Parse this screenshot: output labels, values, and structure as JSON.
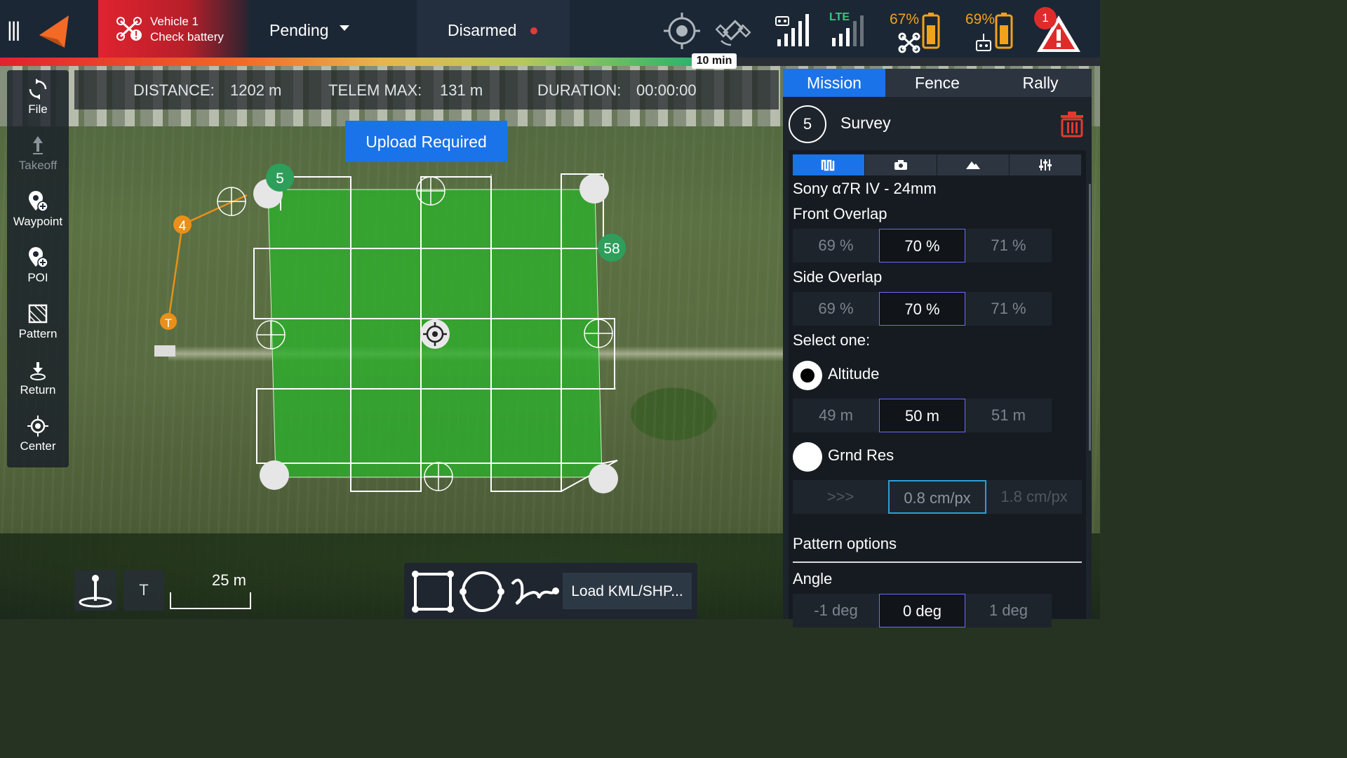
{
  "topbar": {
    "vehicle_name": "Vehicle 1",
    "vehicle_status": "Check battery",
    "flight_mode": "Pending",
    "arm_state": "Disarmed",
    "lte_label": "LTE",
    "drone_battery": "67%",
    "controller_battery": "69%",
    "alert_count": "1",
    "flight_time": "10 min",
    "progress_fraction": 0.63
  },
  "stats": {
    "distance_label": "DISTANCE:",
    "distance_value": "1202 m",
    "telem_label": "TELEM MAX:",
    "telem_value": "131 m",
    "duration_label": "DURATION:",
    "duration_value": "00:00:00"
  },
  "left_toolbar": {
    "items": [
      {
        "label": "File",
        "icon": "file-sync-icon",
        "enabled": true
      },
      {
        "label": "Takeoff",
        "icon": "takeoff-icon",
        "enabled": false
      },
      {
        "label": "Waypoint",
        "icon": "waypoint-icon",
        "enabled": true
      },
      {
        "label": "POI",
        "icon": "poi-icon",
        "enabled": true
      },
      {
        "label": "Pattern",
        "icon": "pattern-icon",
        "enabled": true
      },
      {
        "label": "Return",
        "icon": "return-icon",
        "enabled": true
      },
      {
        "label": "Center",
        "icon": "center-icon",
        "enabled": true
      }
    ]
  },
  "map": {
    "upload_button": "Upload Required",
    "markers": {
      "takeoff": "T",
      "wp4": "4",
      "survey_start": "5",
      "survey_end": "58"
    },
    "scale_label": "25 m",
    "takeoff_toggle": "T",
    "load_kml": "Load KML/SHP..."
  },
  "right_panel": {
    "tabs": [
      "Mission",
      "Fence",
      "Rally"
    ],
    "active_tab": "Mission",
    "seq": "5",
    "item_title": "Survey",
    "camera": "Sony α7R IV - 24mm",
    "front_overlap_label": "Front Overlap",
    "front_overlap": [
      "69 %",
      "70 %",
      "71 %"
    ],
    "side_overlap_label": "Side Overlap",
    "side_overlap": [
      "69 %",
      "70 %",
      "71 %"
    ],
    "select_one": "Select one:",
    "altitude_label": "Altitude",
    "altitude": [
      "49 m",
      "50 m",
      "51 m"
    ],
    "grnd_res_label": "Grnd Res",
    "grnd_res": [
      ">>>",
      "0.8 cm/px",
      "1.8 cm/px"
    ],
    "pattern_options": "Pattern options",
    "angle_label": "Angle",
    "angle": [
      "-1 deg",
      "0 deg",
      "1 deg"
    ]
  },
  "colors": {
    "accent": "#1a73e8",
    "alert": "#e0232f",
    "battery": "#f2a21a",
    "survey_fill": "#2bb12b",
    "marker_green": "#2e9e5b",
    "marker_orange": "#e8901a"
  }
}
